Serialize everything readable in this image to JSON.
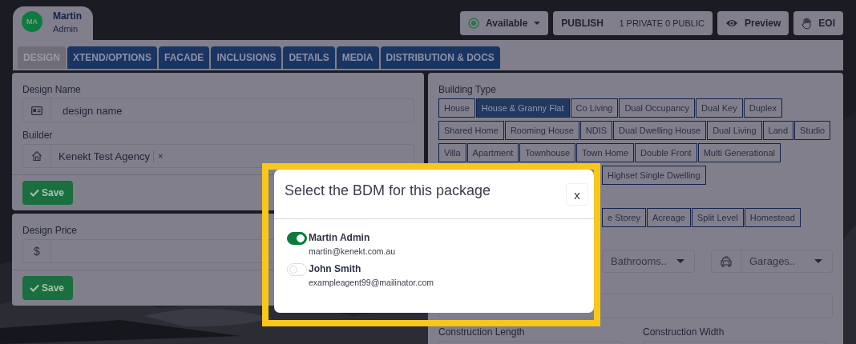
{
  "user": {
    "initials": "MA",
    "name": "Martin",
    "role": "Admin"
  },
  "header_buttons": [
    {
      "kind": "status",
      "label": "Available"
    },
    {
      "kind": "publish",
      "label": "PUBLISH",
      "detail": "1 PRIVATE 0 PUBLIC"
    },
    {
      "kind": "preview",
      "label": "Preview"
    },
    {
      "kind": "eoi",
      "label": "EOI"
    }
  ],
  "tabs": [
    {
      "label": "DESIGN",
      "selected": true
    },
    {
      "label": "XTEND/OPTIONS",
      "selected": false
    },
    {
      "label": "FACADE",
      "selected": false
    },
    {
      "label": "INCLUSIONS",
      "selected": false
    },
    {
      "label": "DETAILS",
      "selected": false
    },
    {
      "label": "MEDIA",
      "selected": false
    },
    {
      "label": "DISTRIBUTION & DOCS",
      "selected": false
    }
  ],
  "design_panel": {
    "fields": [
      {
        "label": "Design Name",
        "kind": "text",
        "placeholder": "design name"
      },
      {
        "label": "Builder",
        "kind": "select",
        "value": "Kenekt Test Agency",
        "remove": "×"
      }
    ],
    "save": "Save"
  },
  "price_panel": {
    "label": "Design Price",
    "prefix": "$",
    "save": "Save"
  },
  "building_type": {
    "label": "Building Type",
    "options": [
      {
        "label": "House",
        "selected": false
      },
      {
        "label": "House & Granny Flat",
        "selected": true
      },
      {
        "label": "Co Living",
        "selected": false
      },
      {
        "label": "Dual Occupancy",
        "selected": false
      },
      {
        "label": "Dual Key",
        "selected": false
      },
      {
        "label": "Duplex",
        "selected": false
      },
      {
        "label": "Shared Home",
        "selected": false
      },
      {
        "label": "Rooming House",
        "selected": false
      },
      {
        "label": "NDIS",
        "selected": false
      },
      {
        "label": "Dual Dwelling House",
        "selected": false
      },
      {
        "label": "Dual Living",
        "selected": false
      },
      {
        "label": "Land",
        "selected": false
      },
      {
        "label": "Studio",
        "selected": false
      },
      {
        "label": "Villa",
        "selected": false
      },
      {
        "label": "Apartment",
        "selected": false
      },
      {
        "label": "Townhouse",
        "selected": false
      },
      {
        "label": "Town Home",
        "selected": false
      },
      {
        "label": "Double Front",
        "selected": false
      },
      {
        "label": "Multi Generational",
        "selected": false
      }
    ],
    "options_continued": [
      {
        "label": "Highset Single Dwelling",
        "selected": false
      }
    ]
  },
  "storey_options": [
    {
      "label": "e Storey",
      "selected": false
    },
    {
      "label": "Acreage",
      "selected": false
    },
    {
      "label": "Split Level",
      "selected": false
    },
    {
      "label": "Homestead",
      "selected": false
    }
  ],
  "selects": [
    {
      "kind": "bath",
      "placeholder": "Bathrooms.."
    },
    {
      "kind": "car",
      "placeholder": "Garages.."
    }
  ],
  "construction": [
    {
      "label": "Construction Length"
    },
    {
      "label": "Construction Width"
    }
  ],
  "modal": {
    "title": "Select the BDM for this package",
    "close": "x",
    "options": [
      {
        "name": "Martin Admin",
        "email": "martin@kenekt.com.au",
        "on": true
      },
      {
        "name": "John Smith",
        "email": "exampleagent99@mailinator.com",
        "on": false
      }
    ]
  }
}
